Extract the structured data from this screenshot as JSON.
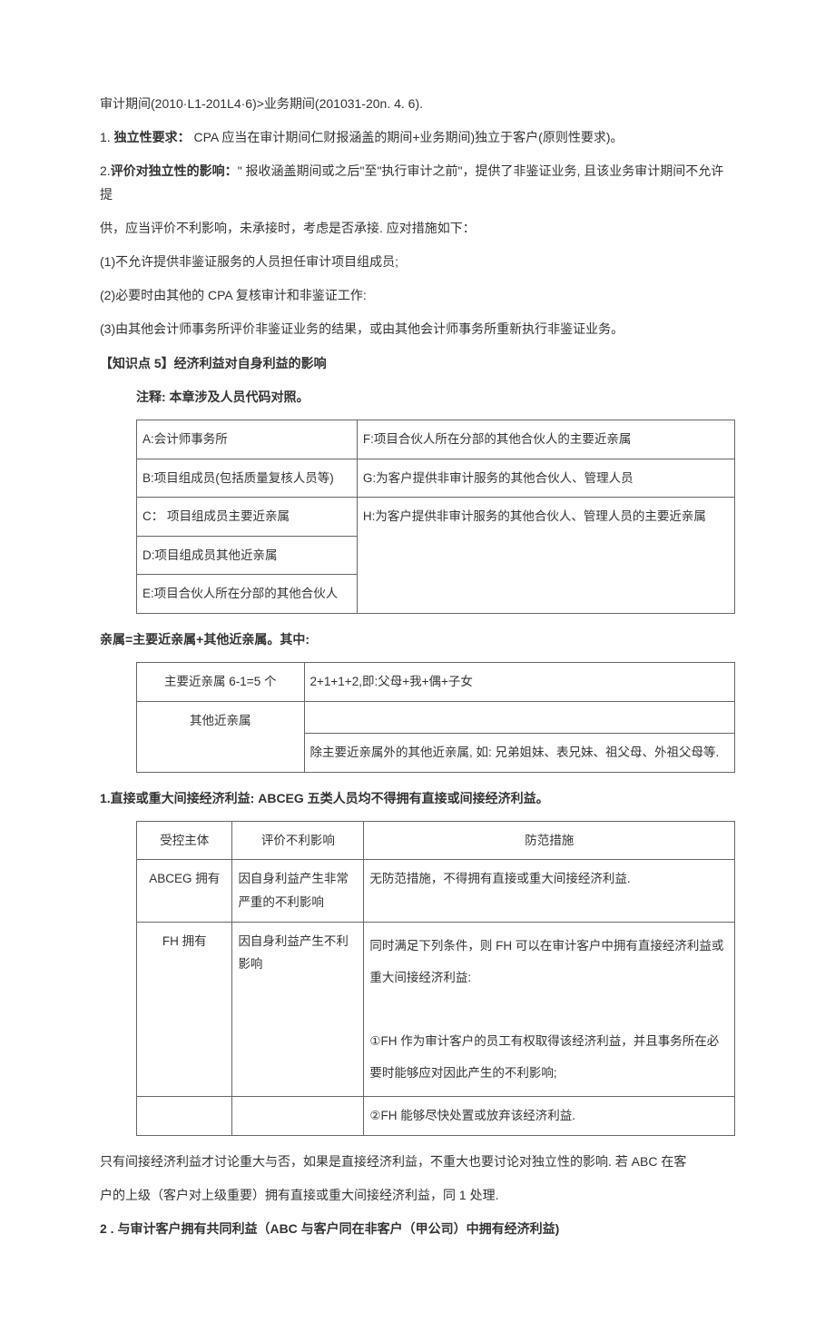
{
  "p1": "审计期间(2010·L1-201L4·6)>业务期间(201031-20n. 4. 6).",
  "p2_prefix": "1. ",
  "p2_bold": "独立性要求：",
  "p2_rest": " CPA 应当在审计期间仁财报涵盖的期间+业务期间)独立于客户(原则性要求)。",
  "p3_prefix": "2.",
  "p3_bold": "评价对独立性的影响：",
  "p3_rest": "\" 报收涵盖期间或之后\"至\"执行审计之前\"，提供了非鉴证业务, 且该业务审计期间不允许提",
  "p4": "供，应当评价不利影响，未承接时，考虑是否承接. 应对措施如下：",
  "p5": "(1)不允许提供非鉴证服务的人员担任审计项目组成员;",
  "p6": "(2)必要时由其他的 CPA 复核审计和非鉴证工作:",
  "p7": "(3)由其他会计师事务所评价非鉴证业务的结果，或由其他会计师事务所重新执行非鉴证业务。",
  "kp_heading": "【知识点 5】经济利益对自身利益的影响",
  "note1": "注释:  本章涉及人员代码对照。",
  "t1": {
    "r1c1": "A:会计师事务所",
    "r1c2": "F:项目合伙人所在分部的其他合伙人的主要近亲属",
    "r2c1": "B:项目组成员(包括质量复核人员等)",
    "r2c2": "G:为客户提供非审计服务的其他合伙人、管理人员",
    "r3c1": "C：  项目组成员主要近亲属",
    "r3c2": "H:为客户提供非审计服务的其他合伙人、管理人员的主要近亲属",
    "r4c1": "D:项目组成员其他近亲属",
    "r5c1": "E:项目合伙人所在分部的其他合伙人"
  },
  "rel_intro": "亲属=主要近亲属+其他近亲属。其中:",
  "t2": {
    "r1c1": "主要近亲属 6-1=5 个",
    "r1c2": "2+1+1+2,即:父母+我+偶+子女",
    "r2c1": "其他近亲属",
    "r2c2": "除主要近亲属外的其他近亲属, 如: 兄弟姐妹、表兄妹、祖父母、外祖父母等.",
    "r2c2_blank": ""
  },
  "sec1_heading": "1.直接或重大间接经济利益:  ABCEG 五类人员均不得拥有直接或间接经济利益。",
  "t3": {
    "h1": "受控主体",
    "h2": "评价不利影响",
    "h3": "防范措施",
    "r1c1": "ABCEG 拥有",
    "r1c2": "因自身利益产生非常严重的不利影响",
    "r1c3": "无防范措施，不得拥有直接或重大间接经济利益.",
    "r2c1": "FH 拥有",
    "r2c2": "因自身利益产生不利影响",
    "r2c3": "同时满足下列条件，则 FH 可以在审计客户中拥有直接经济利益或重大间接经济利益:\n\n①FH 作为审计客户的员工有权取得该经济利益，并且事务所在必要时能够应对因此产生的不利影响;",
    "r3c3": "②FH 能够尽快处置或放弃该经济利益."
  },
  "p8": "只有间接经济利益才讨论重大与否，如果是直接经济利益，不重大也要讨论对独立性的影响. 若 ABC 在客",
  "p9": "户的上级（客户对上级重要）拥有直接或重大间接经济利益，同 1 处理.",
  "sec2_heading": "2  . 与审计客户拥有共同利益（ABC 与客户同在非客户（甲公司）中拥有经济利益)"
}
